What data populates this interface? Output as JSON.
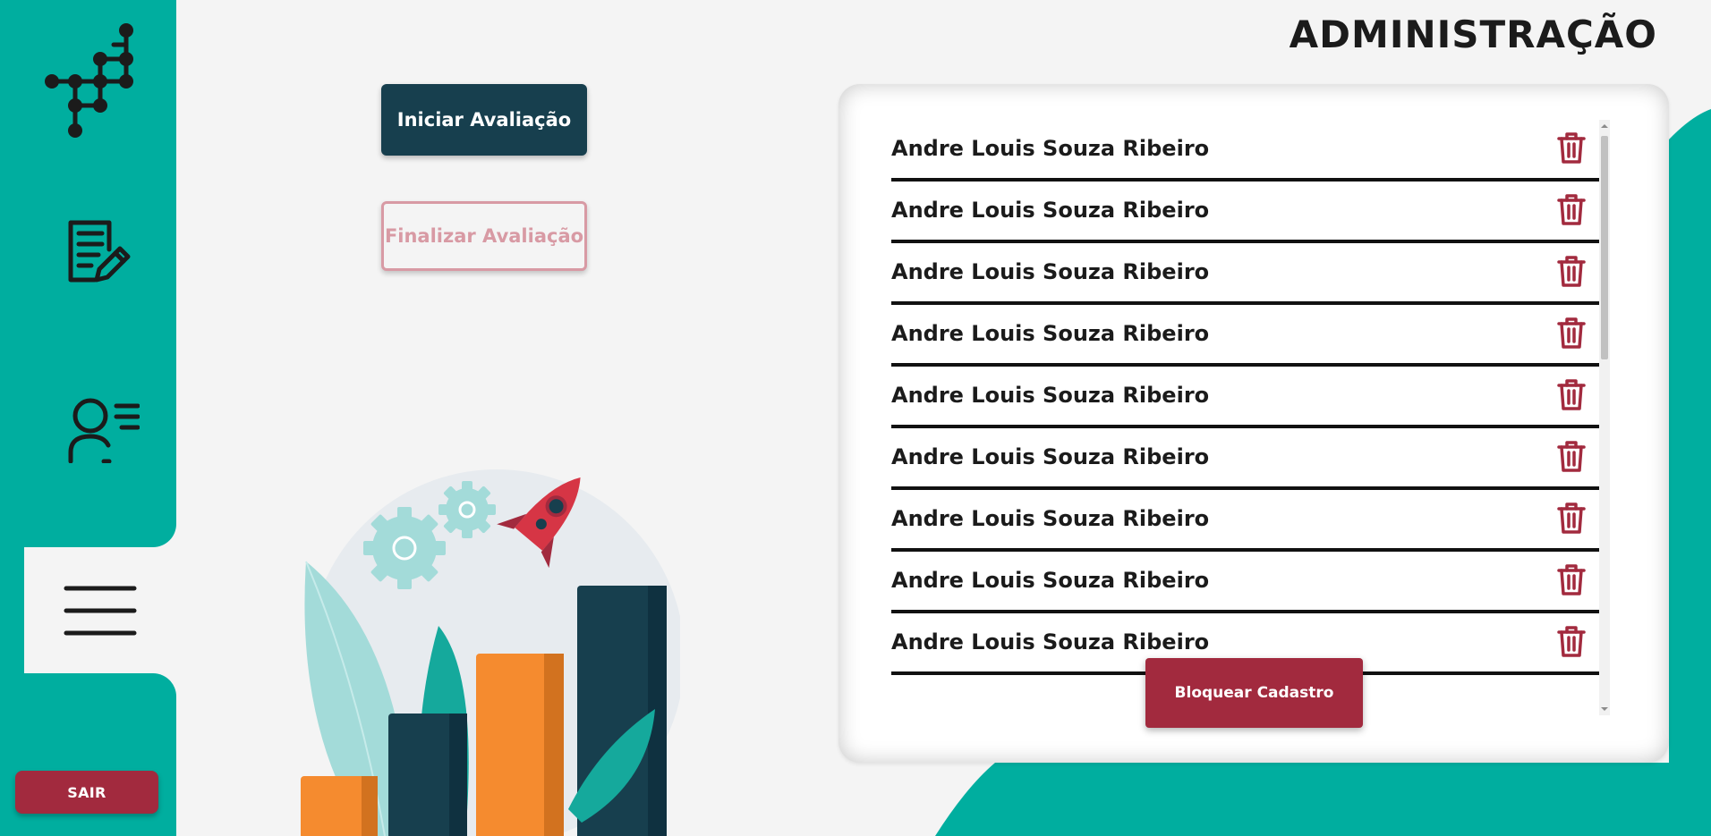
{
  "header": {
    "title": "ADMINISTRAÇÃO"
  },
  "sidebar": {
    "logo_icon": "molecule-network-icon",
    "nav_items": [
      {
        "icon": "document-edit-icon"
      },
      {
        "icon": "user-list-icon"
      },
      {
        "icon": "hamburger-menu-icon",
        "active": true
      }
    ],
    "logout_label": "SAIR"
  },
  "actions": {
    "start_label": "Iniciar Avaliação",
    "finish_label": "Finalizar Avaliação"
  },
  "students": [
    {
      "name": "Andre Louis Souza Ribeiro"
    },
    {
      "name": "Andre Louis Souza Ribeiro"
    },
    {
      "name": "Andre Louis Souza Ribeiro"
    },
    {
      "name": "Andre Louis Souza Ribeiro"
    },
    {
      "name": "Andre Louis Souza Ribeiro"
    },
    {
      "name": "Andre Louis Souza Ribeiro"
    },
    {
      "name": "Andre Louis Souza Ribeiro"
    },
    {
      "name": "Andre Louis Souza Ribeiro"
    },
    {
      "name": "Andre Louis Souza Ribeiro"
    }
  ],
  "panel": {
    "block_label": "Bloquear Cadastro"
  },
  "colors": {
    "teal": "#00ae9f",
    "dark_teal": "#173f4e",
    "crimson": "#a22a3e",
    "muted_pink": "#d89aa4",
    "orange": "#f58b2f"
  }
}
